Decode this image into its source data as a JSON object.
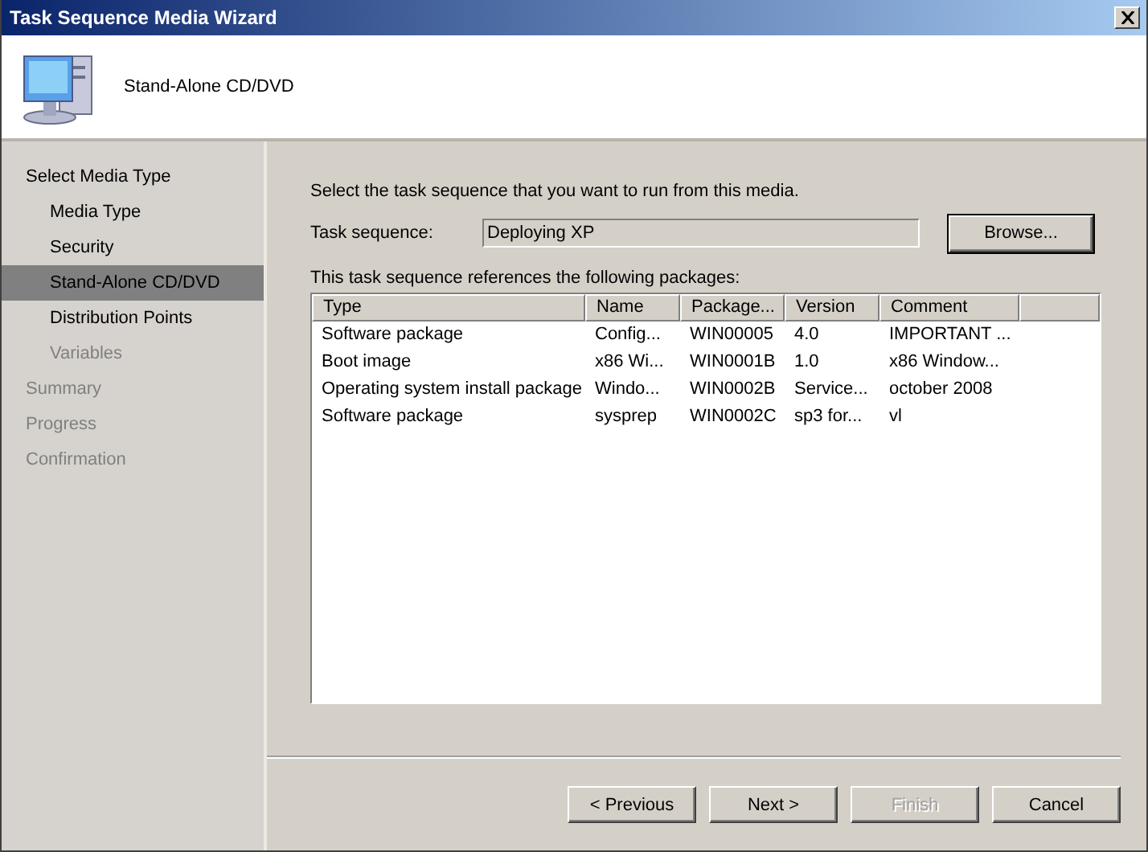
{
  "window": {
    "title": "Task Sequence Media Wizard"
  },
  "header": {
    "title": "Stand-Alone CD/DVD"
  },
  "sidebar": {
    "items": [
      {
        "label": "Select Media Type",
        "selected": false,
        "disabled": false,
        "children": [
          {
            "label": "Media Type",
            "selected": false,
            "disabled": false
          },
          {
            "label": "Security",
            "selected": false,
            "disabled": false
          },
          {
            "label": "Stand-Alone CD/DVD",
            "selected": true,
            "disabled": false
          },
          {
            "label": "Distribution Points",
            "selected": false,
            "disabled": false
          },
          {
            "label": "Variables",
            "selected": false,
            "disabled": true
          }
        ]
      },
      {
        "label": "Summary",
        "selected": false,
        "disabled": true
      },
      {
        "label": "Progress",
        "selected": false,
        "disabled": true
      },
      {
        "label": "Confirmation",
        "selected": false,
        "disabled": true
      }
    ]
  },
  "instruction": "Select the task sequence that you want to run from this media.",
  "task_sequence": {
    "label": "Task sequence:",
    "value": "Deploying XP",
    "browse": "Browse..."
  },
  "packages_label": "This task sequence references the following packages:",
  "table": {
    "columns": [
      "Type",
      "Name",
      "Package...",
      "Version",
      "Comment"
    ],
    "rows": [
      [
        "Software package",
        "Config...",
        "WIN00005",
        "4.0",
        "IMPORTANT ..."
      ],
      [
        "Boot image",
        "x86 Wi...",
        "WIN0001B",
        "1.0",
        "x86 Window..."
      ],
      [
        "Operating system install package",
        "Windo...",
        "WIN0002B",
        "Service...",
        "october 2008"
      ],
      [
        "Software package",
        "sysprep",
        "WIN0002C",
        "sp3 for...",
        "vl"
      ]
    ]
  },
  "buttons": [
    {
      "label": "< Previous",
      "disabled": false
    },
    {
      "label": "Next >",
      "disabled": false
    },
    {
      "label": "Finish",
      "disabled": true
    },
    {
      "label": "Cancel",
      "disabled": false
    }
  ]
}
